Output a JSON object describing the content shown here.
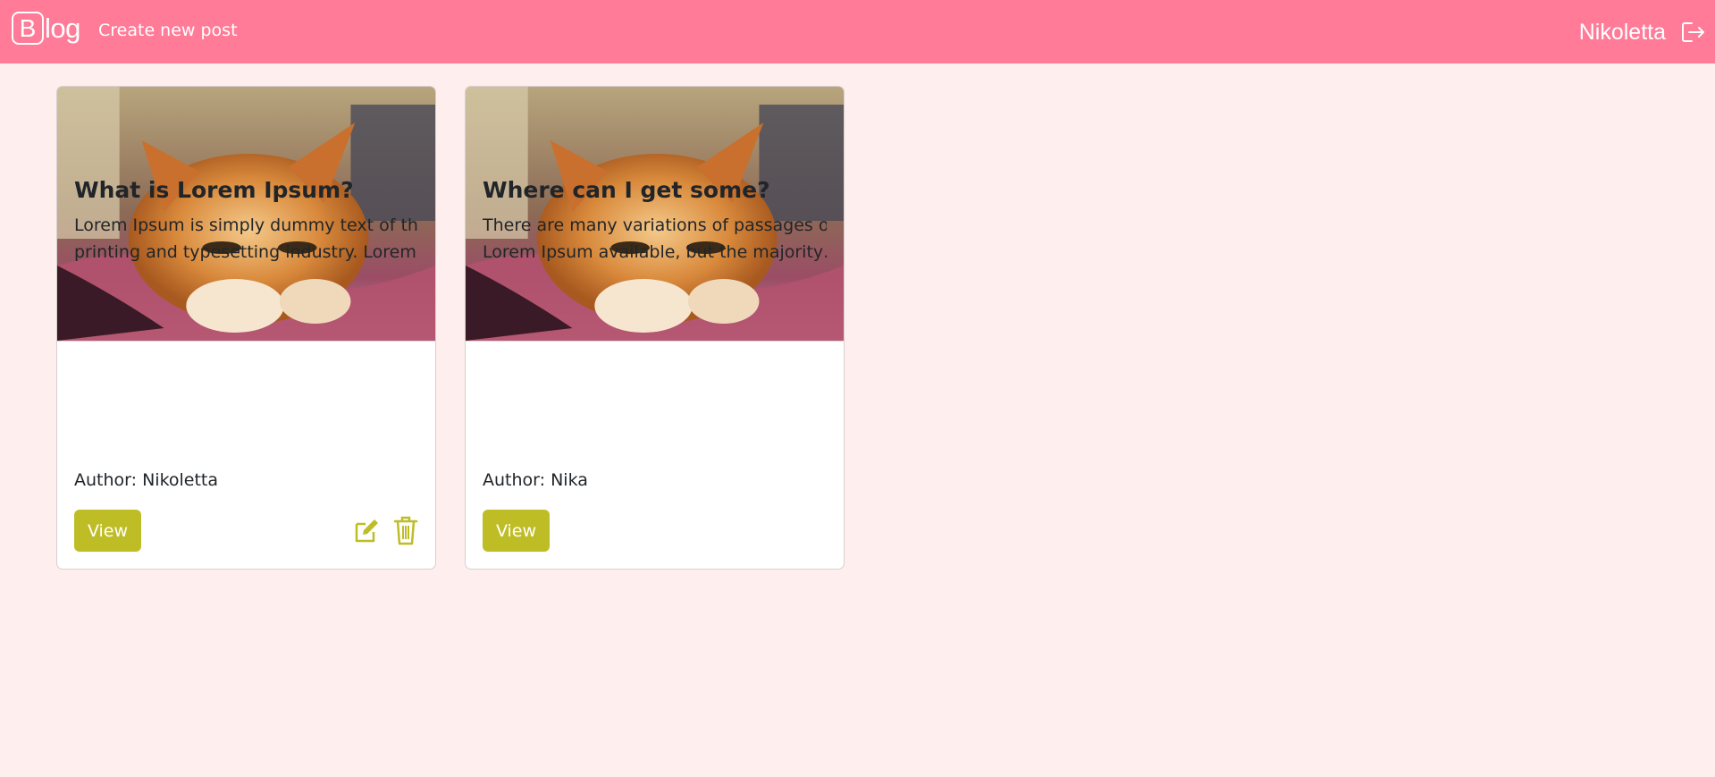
{
  "navbar": {
    "brand_letter": "B",
    "brand_rest": "log",
    "create_link": "Create new post",
    "username": "Nikoletta",
    "logout_icon": "logout-icon",
    "bg_color": "#ff7b98"
  },
  "posts": [
    {
      "title": "What is Lorem Ipsum?",
      "text_line1": "Lorem Ipsum is simply dummy text of the",
      "text_line2": "printing and typesetting industry. Lorem…",
      "author_label": "Author: Nikoletta",
      "view_label": "View",
      "has_edit": true,
      "has_delete": true
    },
    {
      "title": "Where can I get some?",
      "text_line1": "There are many variations of passages of",
      "text_line2": "Lorem Ipsum available, but the majority…",
      "author_label": "Author: Nika",
      "view_label": "View",
      "has_edit": false,
      "has_delete": false
    }
  ],
  "colors": {
    "page_bg": "#ffeeee",
    "accent": "#bfbd26"
  }
}
